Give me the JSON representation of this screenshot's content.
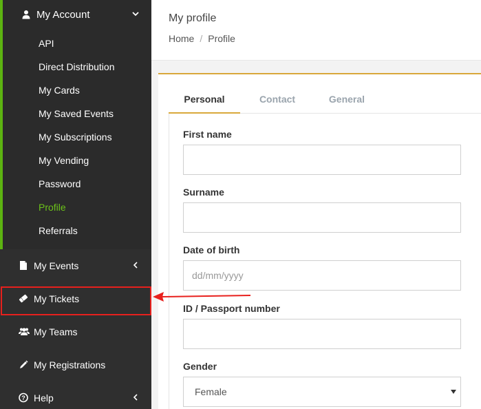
{
  "sidebar": {
    "account": {
      "label": "My Account",
      "icon": "user-icon"
    },
    "account_items": [
      {
        "label": "API"
      },
      {
        "label": "Direct Distribution"
      },
      {
        "label": "My Cards"
      },
      {
        "label": "My Saved Events"
      },
      {
        "label": "My Subscriptions"
      },
      {
        "label": "My Vending"
      },
      {
        "label": "Password"
      },
      {
        "label": "Profile",
        "active": true
      },
      {
        "label": "Referrals"
      }
    ],
    "nav": [
      {
        "label": "My Events",
        "icon": "file-icon"
      },
      {
        "label": "My Tickets",
        "icon": "ticket-icon"
      },
      {
        "label": "My Teams",
        "icon": "users-icon"
      },
      {
        "label": "My Registrations",
        "icon": "pencil-icon"
      },
      {
        "label": "Help",
        "icon": "question-icon"
      }
    ],
    "active_color": "#6cc31a"
  },
  "header": {
    "title": "My profile",
    "breadcrumb": {
      "home": "Home",
      "separator": "/",
      "current": "Profile"
    }
  },
  "tabs": [
    {
      "label": "Personal",
      "active": true
    },
    {
      "label": "Contact",
      "active": false
    },
    {
      "label": "General",
      "active": false
    }
  ],
  "form": {
    "first_name": {
      "label": "First name",
      "value": ""
    },
    "surname": {
      "label": "Surname",
      "value": ""
    },
    "dob": {
      "label": "Date of birth",
      "placeholder": "dd/mm/yyyy"
    },
    "id_passport": {
      "label": "ID / Passport number",
      "value": ""
    },
    "gender": {
      "label": "Gender",
      "value": "Female"
    }
  },
  "colors": {
    "accent": "#d9a83a",
    "highlight": "#e8201d",
    "sidebar": "#2f2f2f"
  }
}
